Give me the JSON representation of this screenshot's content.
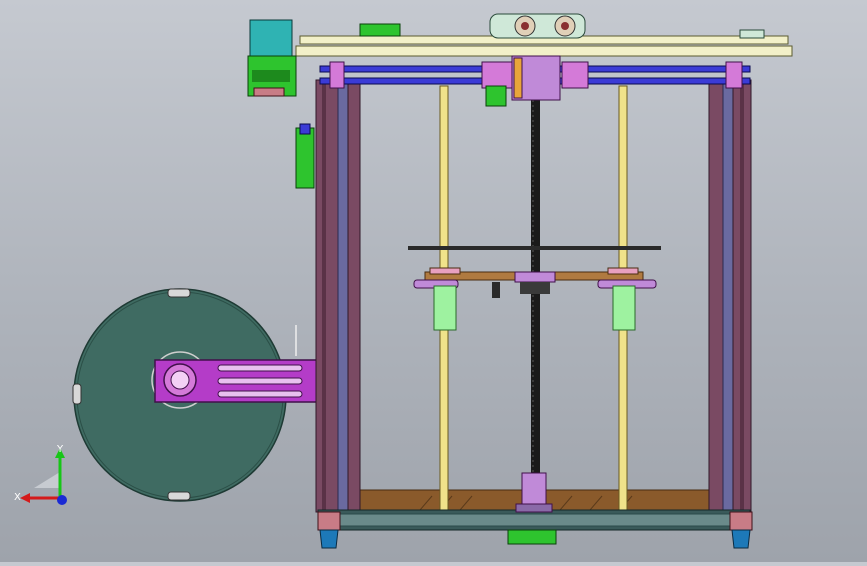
{
  "window": {
    "background_top": "#c5c9d0",
    "background_bottom": "#9ea3ab"
  },
  "colors": {
    "frame_post": "#7a4a63",
    "frame_post_dark": "#5a3247",
    "frame_rail": "#6a6aa0",
    "x_rod": "#3b3bd6",
    "gantry_top": "#f2f0c8",
    "guide_rod": "#f0e28a",
    "lead_screw": "#1a1a1a",
    "bed_wood": "#8a5a2b",
    "bed_plate": "#b07a40",
    "base_plate": "#3a5a5a",
    "stepper_body": "#2fb3b3",
    "stepper_green": "#2ec42e",
    "coupler": "#c08ad8",
    "spool": "#3f6b62",
    "spool_arm": "#b43cc8",
    "foot": "#1d79b8",
    "foot_block": "#c87c86",
    "bushing": "#9ef2a0"
  },
  "icons": {
    "stepper": "stepper-motor-icon",
    "spool": "filament-spool-icon",
    "triad": "coordinate-triad-icon"
  },
  "triad": {
    "x_label": "X",
    "y_label": "Y"
  }
}
